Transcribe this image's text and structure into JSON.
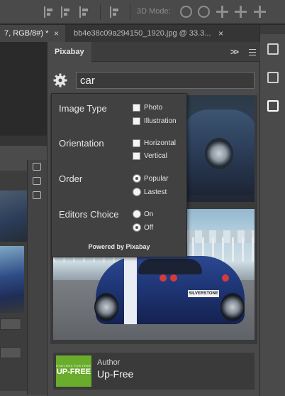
{
  "toolbar": {
    "mode_label": "3D Mode:"
  },
  "tabs": [
    {
      "label": "7, RGB/8#) *",
      "close": "×"
    },
    {
      "label": "bb4e38c09a294150_1920.jpg @ 33.3...",
      "close": "×"
    }
  ],
  "panel": {
    "title": "Pixabay",
    "collapse": ">>",
    "search": {
      "value": "car",
      "placeholder": ""
    }
  },
  "filters": {
    "image_type": {
      "label": "Image Type",
      "options": [
        {
          "label": "Photo",
          "checked": false
        },
        {
          "label": "Illustration",
          "checked": false
        }
      ]
    },
    "orientation": {
      "label": "Orientation",
      "options": [
        {
          "label": "Horizontal",
          "checked": false
        },
        {
          "label": "Vertical",
          "checked": false
        }
      ]
    },
    "order": {
      "label": "Order",
      "options": [
        {
          "label": "Popular",
          "selected": true
        },
        {
          "label": "Lastest",
          "selected": false
        }
      ]
    },
    "editors_choice": {
      "label": "Editors Choice",
      "options": [
        {
          "label": "On",
          "selected": false
        },
        {
          "label": "Off",
          "selected": true
        }
      ]
    },
    "powered_by": "Powered by Pixabay"
  },
  "result_images": {
    "plate_text": "SILVERSTONE"
  },
  "author": {
    "label": "Author",
    "name": "Up-Free",
    "logo_small": "HIGH-RES FOR FREE",
    "logo_big": "UP-FREE",
    "logo_color": "#6aac2b"
  },
  "dock": {
    "icons": [
      "history-icon",
      "3d-cube-icon",
      "pixabay-camera-icon"
    ]
  }
}
